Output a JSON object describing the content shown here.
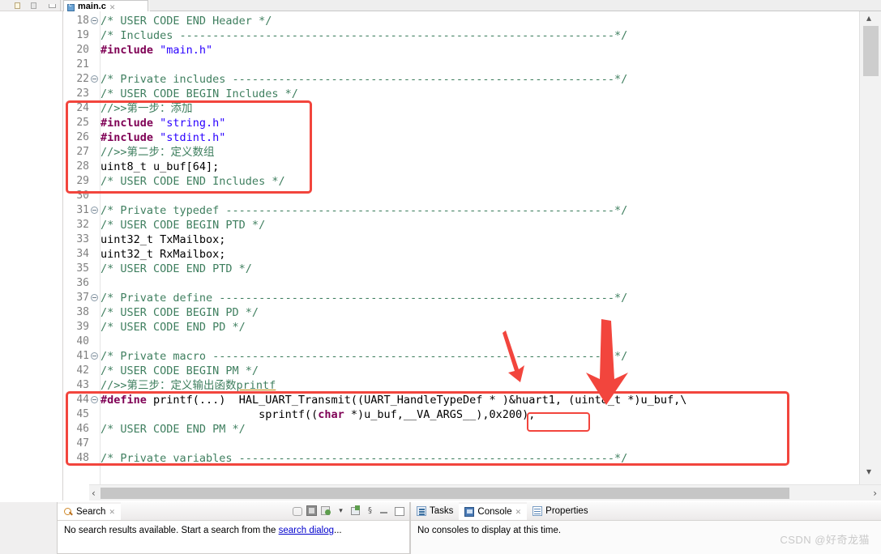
{
  "window": {
    "editor_tab": {
      "label": "main.c",
      "icon": "c-file-icon",
      "close": "✕"
    }
  },
  "editor": {
    "lines": [
      {
        "n": "18",
        "fold": true,
        "parts": [
          {
            "t": "/* USER CODE END Header */",
            "c": "cmt"
          }
        ]
      },
      {
        "n": "19",
        "fold": false,
        "parts": [
          {
            "t": "/* Includes ------------------------------------------------------------------*/",
            "c": "cmt"
          }
        ]
      },
      {
        "n": "20",
        "fold": false,
        "parts": [
          {
            "t": "#include ",
            "c": "kw"
          },
          {
            "t": "\"main.h\"",
            "c": "str"
          }
        ]
      },
      {
        "n": "21",
        "fold": false,
        "parts": []
      },
      {
        "n": "22",
        "fold": true,
        "parts": [
          {
            "t": "/* Private includes ----------------------------------------------------------*/",
            "c": "cmt"
          }
        ]
      },
      {
        "n": "23",
        "fold": false,
        "parts": [
          {
            "t": "/* USER CODE BEGIN Includes */",
            "c": "cmt"
          }
        ]
      },
      {
        "n": "24",
        "fold": false,
        "parts": [
          {
            "t": "//>>第一步：添加",
            "c": "cmt"
          }
        ]
      },
      {
        "n": "25",
        "fold": false,
        "parts": [
          {
            "t": "#include ",
            "c": "kw"
          },
          {
            "t": "\"string.h\"",
            "c": "str"
          }
        ]
      },
      {
        "n": "26",
        "fold": false,
        "parts": [
          {
            "t": "#include ",
            "c": "kw"
          },
          {
            "t": "\"stdint.h\"",
            "c": "str"
          }
        ]
      },
      {
        "n": "27",
        "fold": false,
        "parts": [
          {
            "t": "//>>第二步：定义数组",
            "c": "cmt"
          }
        ]
      },
      {
        "n": "28",
        "fold": false,
        "parts": [
          {
            "t": "uint8_t u_buf[64];",
            "c": ""
          }
        ]
      },
      {
        "n": "29",
        "fold": false,
        "parts": [
          {
            "t": "/* USER CODE END Includes */",
            "c": "cmt"
          }
        ]
      },
      {
        "n": "30",
        "fold": false,
        "parts": []
      },
      {
        "n": "31",
        "fold": true,
        "parts": [
          {
            "t": "/* Private typedef -----------------------------------------------------------*/",
            "c": "cmt"
          }
        ]
      },
      {
        "n": "32",
        "fold": false,
        "parts": [
          {
            "t": "/* USER CODE BEGIN PTD */",
            "c": "cmt"
          }
        ]
      },
      {
        "n": "33",
        "fold": false,
        "parts": [
          {
            "t": "uint32_t TxMailbox;",
            "c": ""
          }
        ]
      },
      {
        "n": "34",
        "fold": false,
        "parts": [
          {
            "t": "uint32_t RxMailbox;",
            "c": ""
          }
        ]
      },
      {
        "n": "35",
        "fold": false,
        "parts": [
          {
            "t": "/* USER CODE END PTD */",
            "c": "cmt"
          }
        ]
      },
      {
        "n": "36",
        "fold": false,
        "parts": []
      },
      {
        "n": "37",
        "fold": true,
        "parts": [
          {
            "t": "/* Private define ------------------------------------------------------------*/",
            "c": "cmt"
          }
        ]
      },
      {
        "n": "38",
        "fold": false,
        "parts": [
          {
            "t": "/* USER CODE BEGIN PD */",
            "c": "cmt"
          }
        ]
      },
      {
        "n": "39",
        "fold": false,
        "parts": [
          {
            "t": "/* USER CODE END PD */",
            "c": "cmt"
          }
        ]
      },
      {
        "n": "40",
        "fold": false,
        "parts": []
      },
      {
        "n": "41",
        "fold": true,
        "parts": [
          {
            "t": "/* Private macro -------------------------------------------------------------*/",
            "c": "cmt"
          }
        ]
      },
      {
        "n": "42",
        "fold": false,
        "parts": [
          {
            "t": "/* USER CODE BEGIN PM */",
            "c": "cmt"
          }
        ]
      },
      {
        "n": "43",
        "fold": false,
        "parts": [
          {
            "t": "//>>第三步：定义输出函数",
            "c": "cmt"
          },
          {
            "t": "printf",
            "c": "cmt und"
          }
        ]
      },
      {
        "n": "44",
        "fold": true,
        "parts": [
          {
            "t": "#define ",
            "c": "kw"
          },
          {
            "t": "printf(...)  HAL_UART_Transmit((UART_HandleTypeDef * )&huart1, (uint8_t *)u_buf,\\",
            "c": ""
          }
        ]
      },
      {
        "n": "45",
        "fold": false,
        "parts": [
          {
            "t": "                        sprintf((",
            "c": ""
          },
          {
            "t": "char",
            "c": "kw"
          },
          {
            "t": " *)u_buf,__VA_ARGS__),0x200);",
            "c": ""
          }
        ]
      },
      {
        "n": "46",
        "fold": false,
        "parts": [
          {
            "t": "/* USER CODE END PM */",
            "c": "cmt"
          }
        ]
      },
      {
        "n": "47",
        "fold": false,
        "parts": []
      },
      {
        "n": "48",
        "fold": false,
        "parts": [
          {
            "t": "/* Private variables ---------------------------------------------------------*/",
            "c": "cmt"
          }
        ]
      }
    ]
  },
  "annotations": {
    "color": "#f2453d",
    "box_includes_label": "red-box-includes",
    "box_macro_label": "red-box-printf-macro",
    "box_huart_label": "red-box-huart1",
    "arrow_small_label": "red-arrow-small",
    "arrow_large_label": "red-arrow-large"
  },
  "scrollbars": {
    "h_left_arrow": "‹",
    "h_right_arrow": "›",
    "v_up_arrow": "▴",
    "v_down_arrow": "▾"
  },
  "search_panel": {
    "tab": {
      "label": "Search",
      "icon": "search-icon",
      "close": "✕"
    },
    "message_prefix": "No search results available. Start a search from the ",
    "link_text": "search dialog",
    "message_suffix": "...",
    "toolbar_icons": [
      "pin-icon",
      "stop-icon",
      "run-icon",
      "view-menu-icon",
      "new-search-icon",
      "options-icon",
      "minimize-icon",
      "maximize-icon"
    ],
    "menu_caret": "▾",
    "options_glyph": "§",
    "minimize_glyph": "–",
    "maximize_glyph": "▭"
  },
  "console_panel": {
    "tabs": [
      {
        "label": "Tasks",
        "icon": "tasks-icon",
        "active": false,
        "close": ""
      },
      {
        "label": "Console",
        "icon": "console-icon",
        "active": true,
        "close": "✕"
      },
      {
        "label": "Properties",
        "icon": "properties-icon",
        "active": false,
        "close": ""
      }
    ],
    "message": "No consoles to display at this time."
  },
  "watermark": {
    "text": "CSDN @好奇龙猫"
  }
}
